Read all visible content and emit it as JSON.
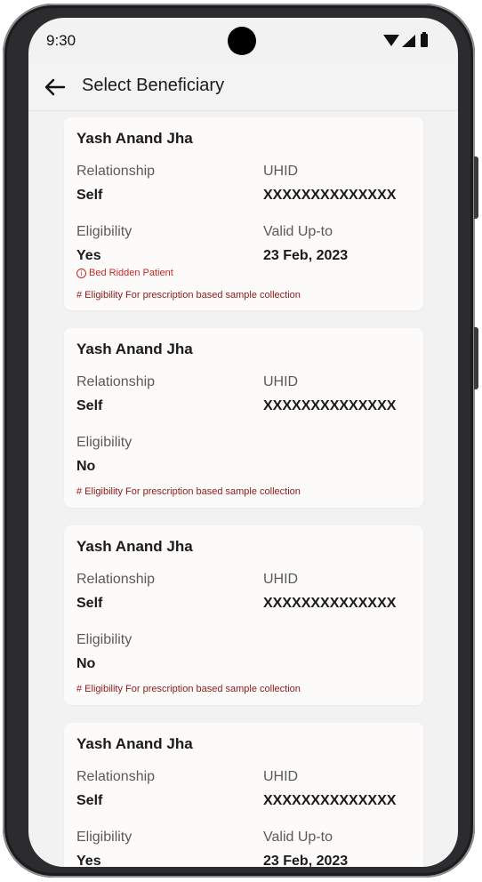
{
  "status_bar": {
    "time": "9:30"
  },
  "header": {
    "title": "Select Beneficiary"
  },
  "beneficiaries": [
    {
      "name": "Yash Anand Jha",
      "relationship_label": "Relationship",
      "relationship": "Self",
      "uhid_label": "UHID",
      "uhid": "XXXXXXXXXXXXXX",
      "eligibility_label": "Eligibility",
      "eligibility": "Yes",
      "valid_label": "Valid Up-to",
      "valid_upto": "23 Feb, 2023",
      "warning": "Bed Ridden Patient",
      "note": "# Eligibility For prescription based sample collection"
    },
    {
      "name": "Yash Anand Jha",
      "relationship_label": "Relationship",
      "relationship": "Self",
      "uhid_label": "UHID",
      "uhid": "XXXXXXXXXXXXXX",
      "eligibility_label": "Eligibility",
      "eligibility": "No",
      "note": "# Eligibility For prescription based sample collection"
    },
    {
      "name": "Yash Anand Jha",
      "relationship_label": "Relationship",
      "relationship": "Self",
      "uhid_label": "UHID",
      "uhid": "XXXXXXXXXXXXXX",
      "eligibility_label": "Eligibility",
      "eligibility": "No",
      "note": "# Eligibility For prescription based sample collection"
    },
    {
      "name": "Yash Anand Jha",
      "relationship_label": "Relationship",
      "relationship": "Self",
      "uhid_label": "UHID",
      "uhid": "XXXXXXXXXXXXXX",
      "eligibility_label": "Eligibility",
      "eligibility": "Yes",
      "valid_label": "Valid Up-to",
      "valid_upto": "23 Feb, 2023"
    }
  ],
  "colors": {
    "warning": "#c62828",
    "note": "#8b1a1a",
    "card": "#fdfbf9"
  }
}
